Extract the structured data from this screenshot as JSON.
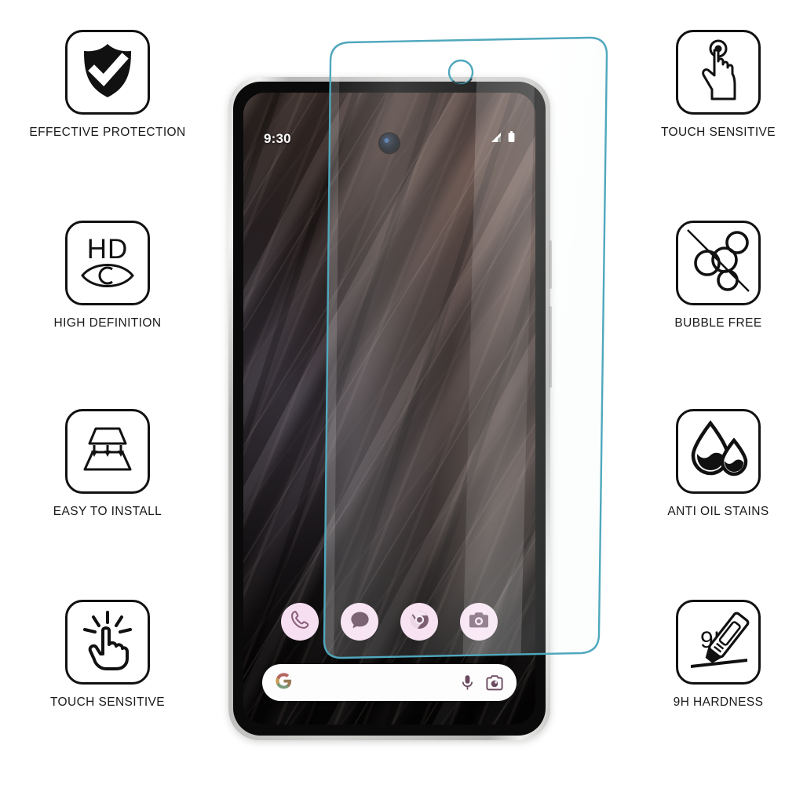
{
  "product": {
    "type": "tempered-glass-screen-protector-infographic",
    "background_color": "#ffffff",
    "accent_color": "#4fa8bd",
    "icon_stroke_color": "#111111"
  },
  "features_left": [
    {
      "id": "effective-protection",
      "label": "EFFECTIVE PROTECTION",
      "icon": "shield-check-icon"
    },
    {
      "id": "high-definition",
      "label": "HIGH DEFINITION",
      "icon": "hd-eye-icon",
      "icon_text": "HD"
    },
    {
      "id": "easy-to-install",
      "label": "EASY TO INSTALL",
      "icon": "layers-down-arrows-icon"
    },
    {
      "id": "touch-sensitive-left",
      "label": "TOUCH SENSITIVE",
      "icon": "tapping-finger-icon"
    }
  ],
  "features_right": [
    {
      "id": "touch-sensitive-right",
      "label": "TOUCH SENSITIVE",
      "icon": "hand-touch-icon"
    },
    {
      "id": "bubble-free",
      "label": "BUBBLE FREE",
      "icon": "no-bubbles-icon"
    },
    {
      "id": "anti-oil-stains",
      "label": "ANTI OIL STAINS",
      "icon": "oil-droplets-icon"
    },
    {
      "id": "9h-hardness",
      "label": "9H HARDNESS",
      "icon": "cutter-knife-icon",
      "icon_text": "9H"
    }
  ],
  "phone": {
    "name": "smartphone-mockup",
    "frame_color": "#cfcfcd",
    "screen": {
      "wallpaper": "dark-feather-texture",
      "status_bar": {
        "time": "9:30",
        "icons": [
          "signal-icon",
          "battery-icon"
        ]
      },
      "dock_apps": [
        {
          "id": "phone",
          "icon": "phone-handset-icon",
          "circle_color": "#f6dff0"
        },
        {
          "id": "messages",
          "icon": "chat-bubble-icon",
          "circle_color": "#f6dff0"
        },
        {
          "id": "chrome",
          "icon": "chrome-icon",
          "circle_color": "#f6dff0"
        },
        {
          "id": "camera",
          "icon": "camera-icon",
          "circle_color": "#f6dff0"
        }
      ],
      "search_bar": {
        "id": "google-search-bar",
        "logo": "google-g-icon",
        "placeholder": "",
        "value": "",
        "actions": [
          "microphone-icon",
          "google-lens-icon"
        ]
      }
    },
    "side_buttons": [
      "power-button",
      "volume-rocker"
    ]
  },
  "protector": {
    "name": "tempered-glass-overlay",
    "edge_color": "#4fa8bd",
    "camera_cutout": "circular-hole",
    "tint": "rgba(255,255,255,0.13)"
  }
}
